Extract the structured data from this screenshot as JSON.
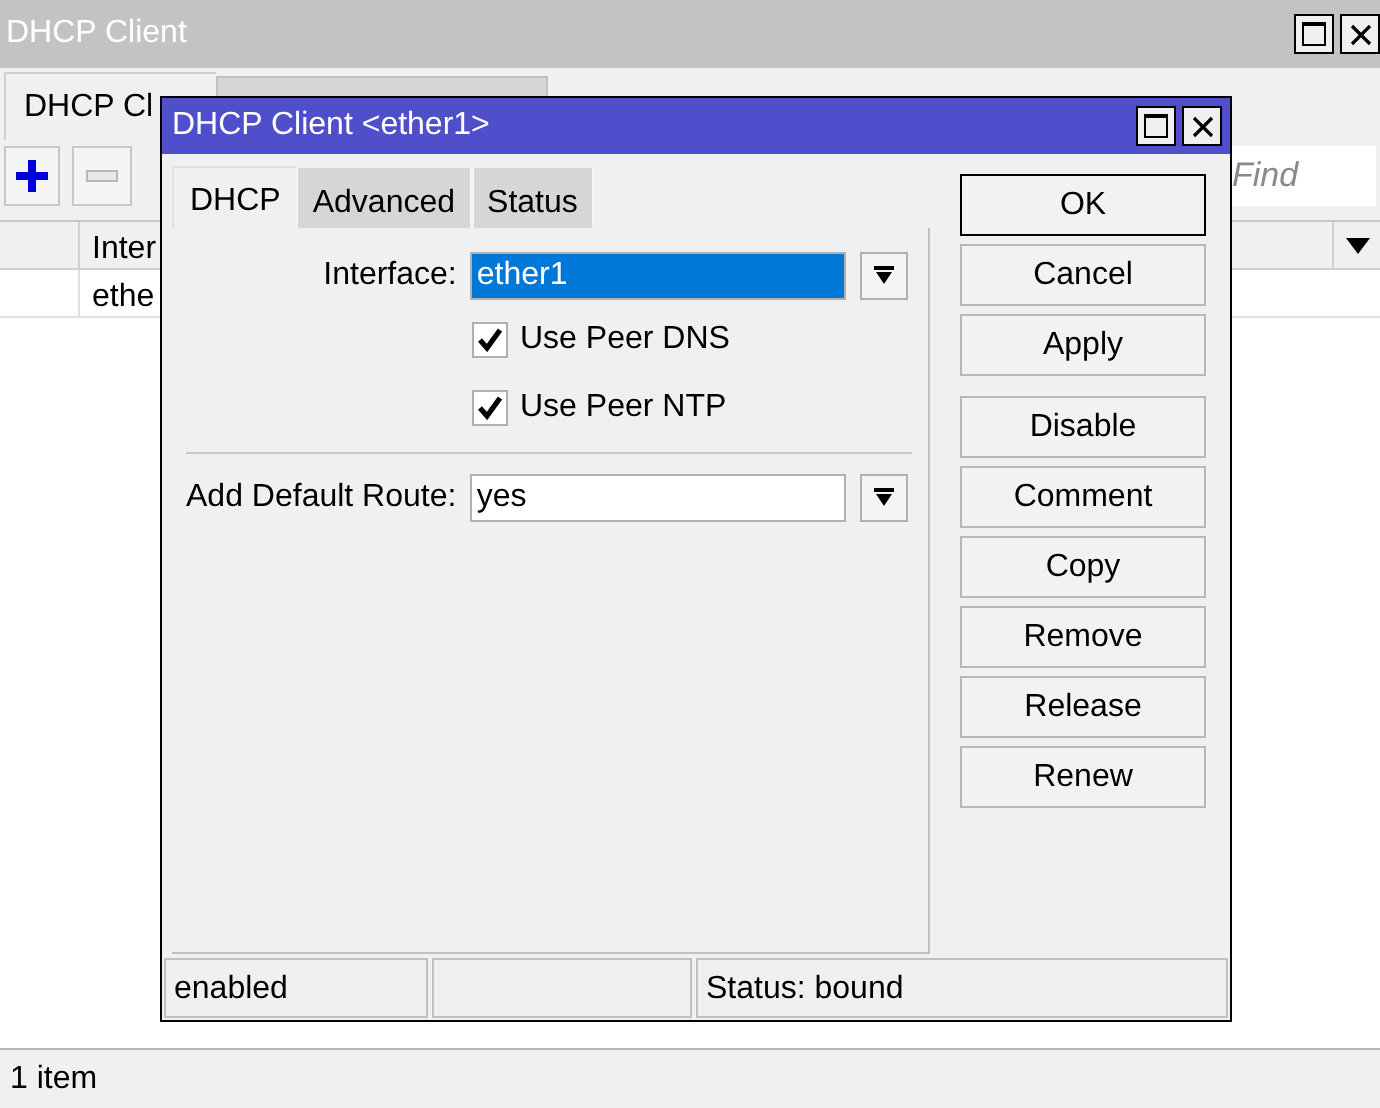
{
  "window": {
    "title": "DHCP Client"
  },
  "tabs": [
    {
      "label": "DHCP Cl",
      "selected": true
    },
    {
      "selected": false
    }
  ],
  "find": {
    "placeholder": "Find"
  },
  "table": {
    "columns": [
      "Inter"
    ],
    "rows": [
      [
        "ethe"
      ]
    ]
  },
  "status_bar": "1 item",
  "dialog": {
    "title": "DHCP Client <ether1>",
    "tabs": [
      {
        "label": "DHCP",
        "selected": true
      },
      {
        "label": "Advanced",
        "selected": false
      },
      {
        "label": "Status",
        "selected": false
      }
    ],
    "interface": {
      "label": "Interface:",
      "value": "ether1",
      "selected": true
    },
    "checkboxes": [
      {
        "label": "Use Peer DNS",
        "checked": true
      },
      {
        "label": "Use Peer NTP",
        "checked": true
      }
    ],
    "default_route": {
      "label": "Add Default Route:",
      "value": "yes"
    },
    "button_groups": [
      [
        "OK",
        "Cancel",
        "Apply"
      ],
      [
        "Disable",
        "Comment",
        "Copy",
        "Remove",
        "Release",
        "Renew"
      ]
    ],
    "status_bar": {
      "left": "enabled",
      "right": "Status: bound"
    }
  }
}
